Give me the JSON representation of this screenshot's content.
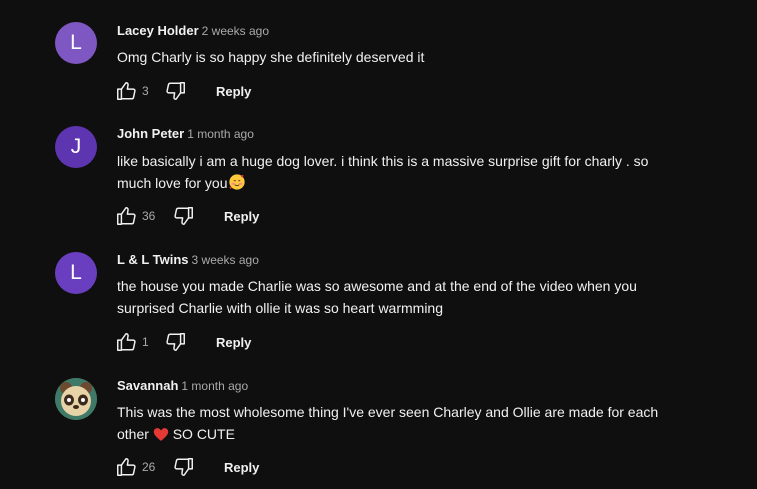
{
  "comments": [
    {
      "author": "Lacey Holder",
      "time": "2 weeks ago",
      "avatar_letter": "L",
      "text": "Omg Charly is so happy she definitely deserved it",
      "likes": "3",
      "reply_label": "Reply"
    },
    {
      "author": "John Peter",
      "time": "1 month ago",
      "avatar_letter": "J",
      "text_line1": "like basically i am a  huge dog lover. i think this is a massive surprise gift for charly . so",
      "text_line2": "much love for you",
      "text_emoji": "smiling-face-with-hearts-emoji",
      "likes": "36",
      "reply_label": "Reply"
    },
    {
      "author": "L & L Twins",
      "time": "3 weeks ago",
      "avatar_letter": "L",
      "text_line1": "the house you made Charlie was so awesome and at the end of the video when you",
      "text_line2": "surprised Charlie with ollie it was so heart warmming",
      "likes": "1",
      "reply_label": "Reply"
    },
    {
      "author": "Savannah",
      "time": "1 month ago",
      "avatar": "panda-avatar",
      "text_line1": "This was the most wholesome thing I've ever seen Charley and Ollie are made for each",
      "text_line2a": "other",
      "text_emoji": "red-heart-emoji",
      "text_line2b": "SO CUTE",
      "likes": "26",
      "reply_label": "Reply"
    }
  ],
  "colors": {
    "background": "#0f0f0f",
    "text": "#f1f1f1",
    "secondary_text": "#aaaaaa"
  }
}
